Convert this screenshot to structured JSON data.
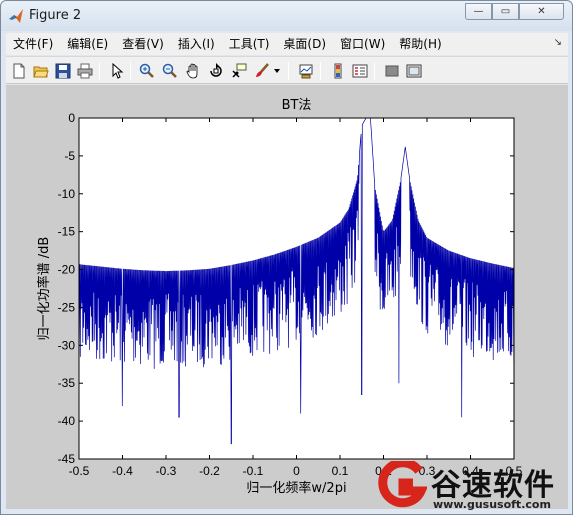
{
  "window": {
    "title": "Figure 2",
    "controls": {
      "minimize": "—",
      "maximize": "▭",
      "close": "✕"
    }
  },
  "menubar": {
    "items": [
      "文件(F)",
      "编辑(E)",
      "查看(V)",
      "插入(I)",
      "工具(T)",
      "桌面(D)",
      "窗口(W)",
      "帮助(H)"
    ],
    "overflow_arrow": "↘"
  },
  "toolbar": {
    "icons": [
      "new-figure-icon",
      "open-file-icon",
      "save-icon",
      "print-icon",
      "pointer-icon",
      "zoom-in-icon",
      "zoom-out-icon",
      "pan-icon",
      "rotate-3d-icon",
      "data-cursor-icon",
      "brush-icon",
      "brush-dropdown-icon",
      "link-plot-icon",
      "colorbar-icon",
      "legend-icon",
      "hide-plot-tools-icon",
      "show-plot-tools-icon"
    ]
  },
  "chart_data": {
    "type": "line",
    "title": "BT法",
    "xlabel": "归一化频率w/2pi",
    "ylabel": "归一化功率谱 /dB",
    "xlim": [
      -0.5,
      0.5
    ],
    "ylim": [
      -45,
      0
    ],
    "xticks": [
      "-0.5",
      "-0.4",
      "-0.3",
      "-0.2",
      "-0.1",
      "0",
      "0.1",
      "0.2",
      "0.3",
      "0.4",
      "0.5"
    ],
    "yticks": [
      "0",
      "-5",
      "-10",
      "-15",
      "-20",
      "-25",
      "-30",
      "-35",
      "-40",
      "-45"
    ],
    "grid": false,
    "line_color": "#0000a8",
    "series": [
      {
        "x": [
          -0.5,
          -0.45,
          -0.4,
          -0.35,
          -0.3,
          -0.25,
          -0.2,
          -0.15,
          -0.1,
          -0.05,
          0.0,
          0.05,
          0.1,
          0.12,
          0.14,
          0.15,
          0.16,
          0.17,
          0.18,
          0.2,
          0.22,
          0.24,
          0.25,
          0.26,
          0.28,
          0.3,
          0.35,
          0.4,
          0.45,
          0.5
        ],
        "envelope_db": [
          -19.3,
          -19.6,
          -19.9,
          -20.1,
          -20.2,
          -20.1,
          -19.9,
          -19.4,
          -18.8,
          -18.0,
          -17.0,
          -15.8,
          -13.8,
          -12.0,
          -8.0,
          -1.0,
          0.0,
          0.0,
          -9.0,
          -15.0,
          -13.5,
          -8.0,
          -3.8,
          -8.0,
          -13.5,
          -15.8,
          -17.5,
          -18.5,
          -19.2,
          -19.8
        ],
        "deep_nulls": [
          {
            "x": -0.5,
            "y": -35.5
          },
          {
            "x": -0.4,
            "y": -38.0
          },
          {
            "x": -0.27,
            "y": -39.5
          },
          {
            "x": -0.15,
            "y": -43.0
          },
          {
            "x": 0.01,
            "y": -39.0
          },
          {
            "x": 0.15,
            "y": -36.5
          },
          {
            "x": 0.235,
            "y": -35.0
          },
          {
            "x": 0.38,
            "y": -39.5
          },
          {
            "x": 0.5,
            "y": -35.0
          }
        ]
      }
    ]
  },
  "watermark": {
    "logo_letter": "G",
    "brand": "谷速软件",
    "url": "www.gususoft.com"
  }
}
